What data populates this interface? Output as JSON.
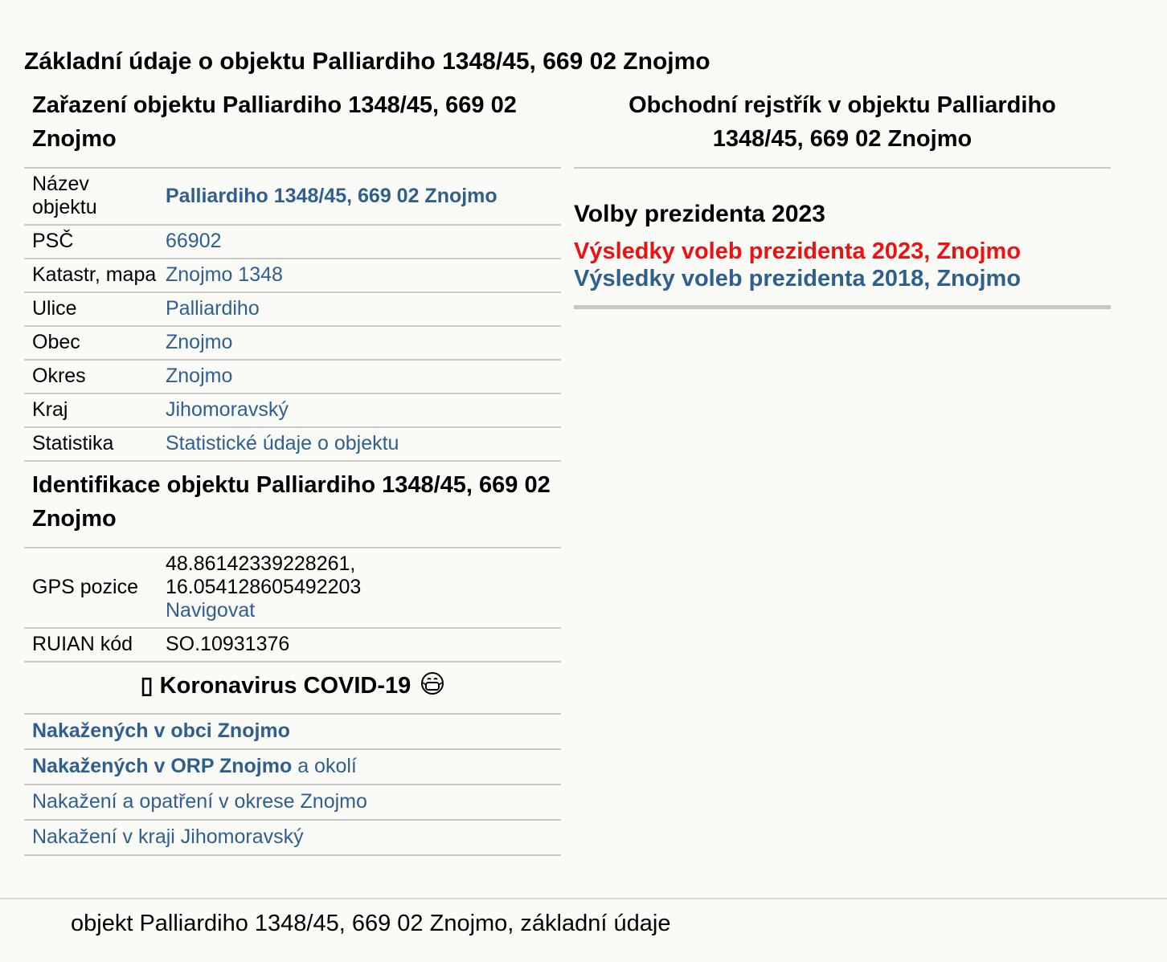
{
  "page_title": "Základní údaje o objektu Palliardiho 1348/45, 669 02 Znojmo",
  "zarazeni": {
    "title": "Zařazení objektu Palliardiho 1348/45, 669 02 Znojmo",
    "rows": [
      {
        "label": "Název objektu",
        "value": "Palliardiho 1348/45, 669 02 Znojmo"
      },
      {
        "label": "PSČ",
        "value": "66902"
      },
      {
        "label": "Katastr, mapa",
        "value": "Znojmo 1348"
      },
      {
        "label": "Ulice",
        "value": "Palliardiho"
      },
      {
        "label": "Obec",
        "value": "Znojmo"
      },
      {
        "label": "Okres",
        "value": "Znojmo"
      },
      {
        "label": "Kraj",
        "value": "Jihomoravský"
      },
      {
        "label": "Statistika",
        "value": "Statistické údaje o objektu"
      }
    ]
  },
  "identifikace": {
    "title": "Identifikace objektu Palliardiho 1348/45, 669 02 Znojmo",
    "gps_label": "GPS pozice",
    "gps_lat": "48.86142339228261,",
    "gps_lon": "16.054128605492203",
    "navigate": "Navigovat",
    "ruian_label": "RUIAN kód",
    "ruian_value": "SO.10931376"
  },
  "covid": {
    "title_prefix": "▯",
    "title": "Koronavirus COVID-19",
    "links": {
      "obec": "Nakažených v obci Znojmo",
      "orp_bold": "Nakažených v ORP Znojmo",
      "orp_rest": "a okolí",
      "okres": "Nakažení a opatření v okrese Znojmo",
      "kraj": "Nakažení v kraji Jihomoravský"
    }
  },
  "rejstrik": {
    "title": "Obchodní rejstřík v objektu Palliardiho 1348/45, 669 02 Znojmo"
  },
  "volby": {
    "title": "Volby prezidenta 2023",
    "link_2023": "Výsledky voleb prezidenta 2023, Znojmo",
    "link_2018": "Výsledky voleb prezidenta 2018, Znojmo",
    "link_2023_color": "#ee1111",
    "link_color": "#2f5f8f"
  },
  "footer": "objekt Palliardiho 1348/45, 669 02 Znojmo, základní údaje"
}
